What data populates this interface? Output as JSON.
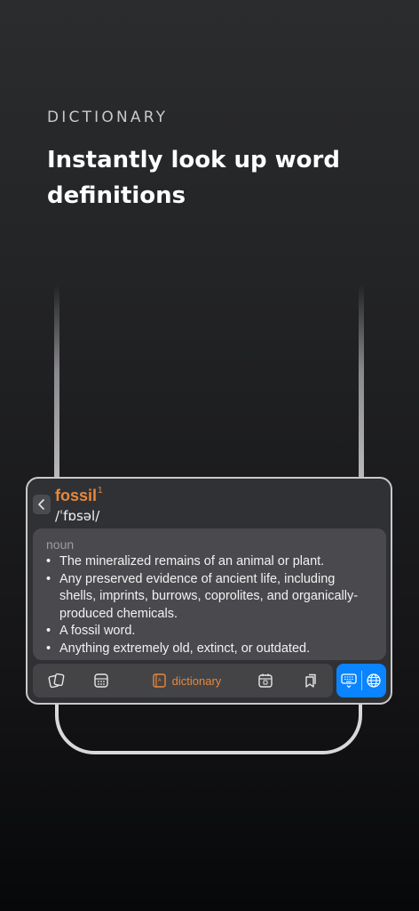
{
  "intro": {
    "eyebrow": "DICTIONARY",
    "headline": "Instantly look up word definitions"
  },
  "entry": {
    "word": "fossil",
    "superscript": "1",
    "pronunciation": "/ˈfɒsəl/",
    "part_of_speech": "noun",
    "definitions": [
      "The mineralized remains of an animal or plant.",
      "Any preserved evidence of ancient life, including shells, imprints, burrows, coprolites, and organically-produced chemicals.",
      "A fossil word.",
      "Anything extremely old, extinct, or outdated."
    ]
  },
  "toolbar": {
    "active_label": "dictionary",
    "icons": [
      "cards-icon",
      "keyboard-grid-icon",
      "book-icon",
      "calendar-icon",
      "bookmarks-icon",
      "keyboard-icon",
      "globe-icon"
    ],
    "accent_color": "#e8873b",
    "pill_color": "#0a84ff"
  }
}
